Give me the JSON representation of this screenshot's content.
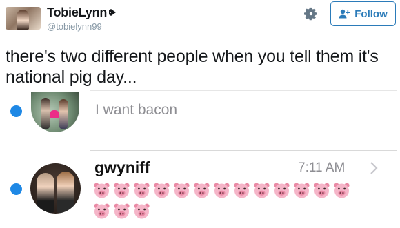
{
  "header": {
    "display_name": "TobieLynn",
    "handle": "@tobielynn99",
    "follow_label": "Follow",
    "icons": [
      "pig-nose-icon",
      "gear-icon",
      "add-user-icon"
    ]
  },
  "tweet": {
    "text": "there's two different people when you tell them it's national pig day..."
  },
  "messages": [
    {
      "preview": "I want bacon"
    },
    {
      "sender": "gwyniff",
      "time": "7:11 AM",
      "emoji_repeat": 16,
      "emoji_name": "pig-face-emoji"
    }
  ],
  "colors": {
    "accent": "#2b7bb9",
    "unread_dot": "#1e88e5",
    "pig_pink": "#f5b5c8"
  }
}
